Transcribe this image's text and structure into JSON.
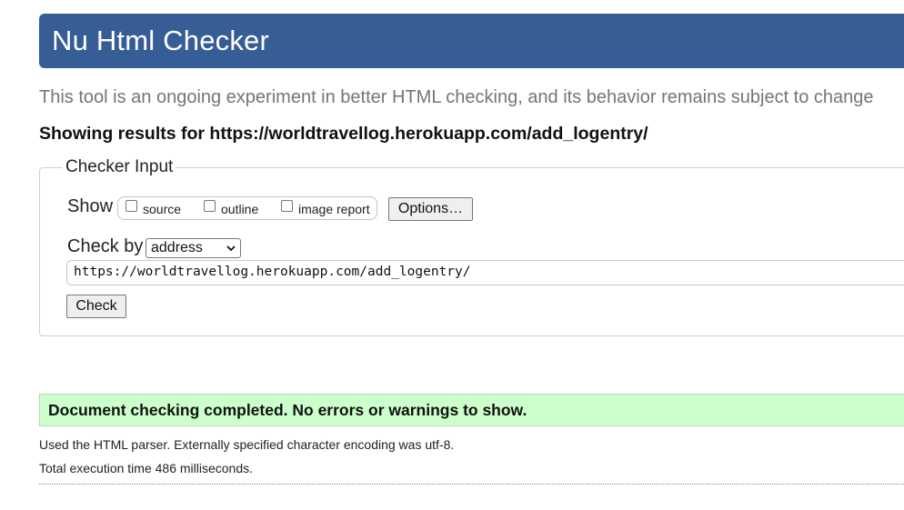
{
  "header": {
    "title": "Nu Html Checker"
  },
  "tagline": "This tool is an ongoing experiment in better HTML checking, and its behavior remains subject to change",
  "showing_results": "Showing results for https://worldtravellog.herokuapp.com/add_logentry/",
  "checker_input": {
    "legend": "Checker Input",
    "show_label": "Show",
    "options": [
      {
        "label": "source",
        "checked": false
      },
      {
        "label": "outline",
        "checked": false
      },
      {
        "label": "image report",
        "checked": false
      }
    ],
    "options_button": "Options…",
    "check_by_label": "Check by",
    "check_by_selected": "address",
    "url_value": "https://worldtravellog.herokuapp.com/add_logentry/",
    "check_button": "Check"
  },
  "result": {
    "message": "Document checking completed. No errors or warnings to show.",
    "parser_info": "Used the HTML parser. Externally specified character encoding was utf-8.",
    "execution_time": "Total execution time 486 milliseconds."
  },
  "colors": {
    "header_bg": "#365d95",
    "success_bg": "#ccffcc"
  }
}
